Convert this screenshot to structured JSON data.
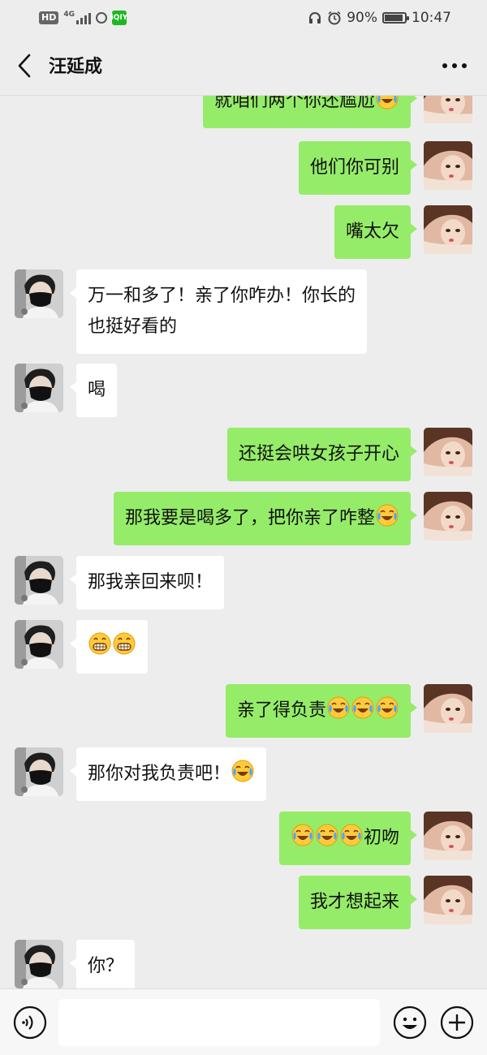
{
  "status_bar": {
    "hd": "HD",
    "network": "4G",
    "iqiyi": "iQIY",
    "battery_text": "90%",
    "battery_level": 0.9,
    "time": "10:47"
  },
  "header": {
    "title": "汪延成",
    "back_icon": "chevron-left-icon",
    "more_icon": "more-dots-icon"
  },
  "messages": [
    {
      "side": "right",
      "text": "就咱们两个你还尴尬",
      "emojis_after": 1
    },
    {
      "side": "right",
      "text": "他们你可别",
      "emojis_after": 0
    },
    {
      "side": "right",
      "text": "嘴太欠",
      "emojis_after": 0
    },
    {
      "side": "left",
      "text": "万一和多了！亲了你咋办！你长的\n也挺好看的",
      "emojis_after": 0
    },
    {
      "side": "left",
      "text": "喝",
      "emojis_after": 0
    },
    {
      "side": "right",
      "text": "还挺会哄女孩子开心",
      "emojis_after": 0
    },
    {
      "side": "right",
      "text": "那我要是喝多了，把你亲了咋整",
      "emojis_after": 1
    },
    {
      "side": "left",
      "text": "那我亲回来呗！",
      "emojis_after": 0
    },
    {
      "side": "left",
      "text": "",
      "emojis_after": 2,
      "emoji_type": "grin"
    },
    {
      "side": "right",
      "text": "亲了得负责",
      "emojis_after": 3
    },
    {
      "side": "left",
      "text": "那你对我负责吧！",
      "emojis_after": 1
    },
    {
      "side": "right",
      "text": "初吻",
      "emojis_before": 3
    },
    {
      "side": "right",
      "text": "我才想起来",
      "emojis_after": 0
    },
    {
      "side": "left",
      "text": "你？",
      "emojis_after": 0
    }
  ],
  "input_bar": {
    "placeholder": "",
    "voice_icon": "voice-icon",
    "emoji_icon": "emoji-icon",
    "plus_icon": "plus-icon"
  },
  "colors": {
    "background": "#ededed",
    "bubble_self": "#95ec69",
    "bubble_other": "#ffffff"
  }
}
